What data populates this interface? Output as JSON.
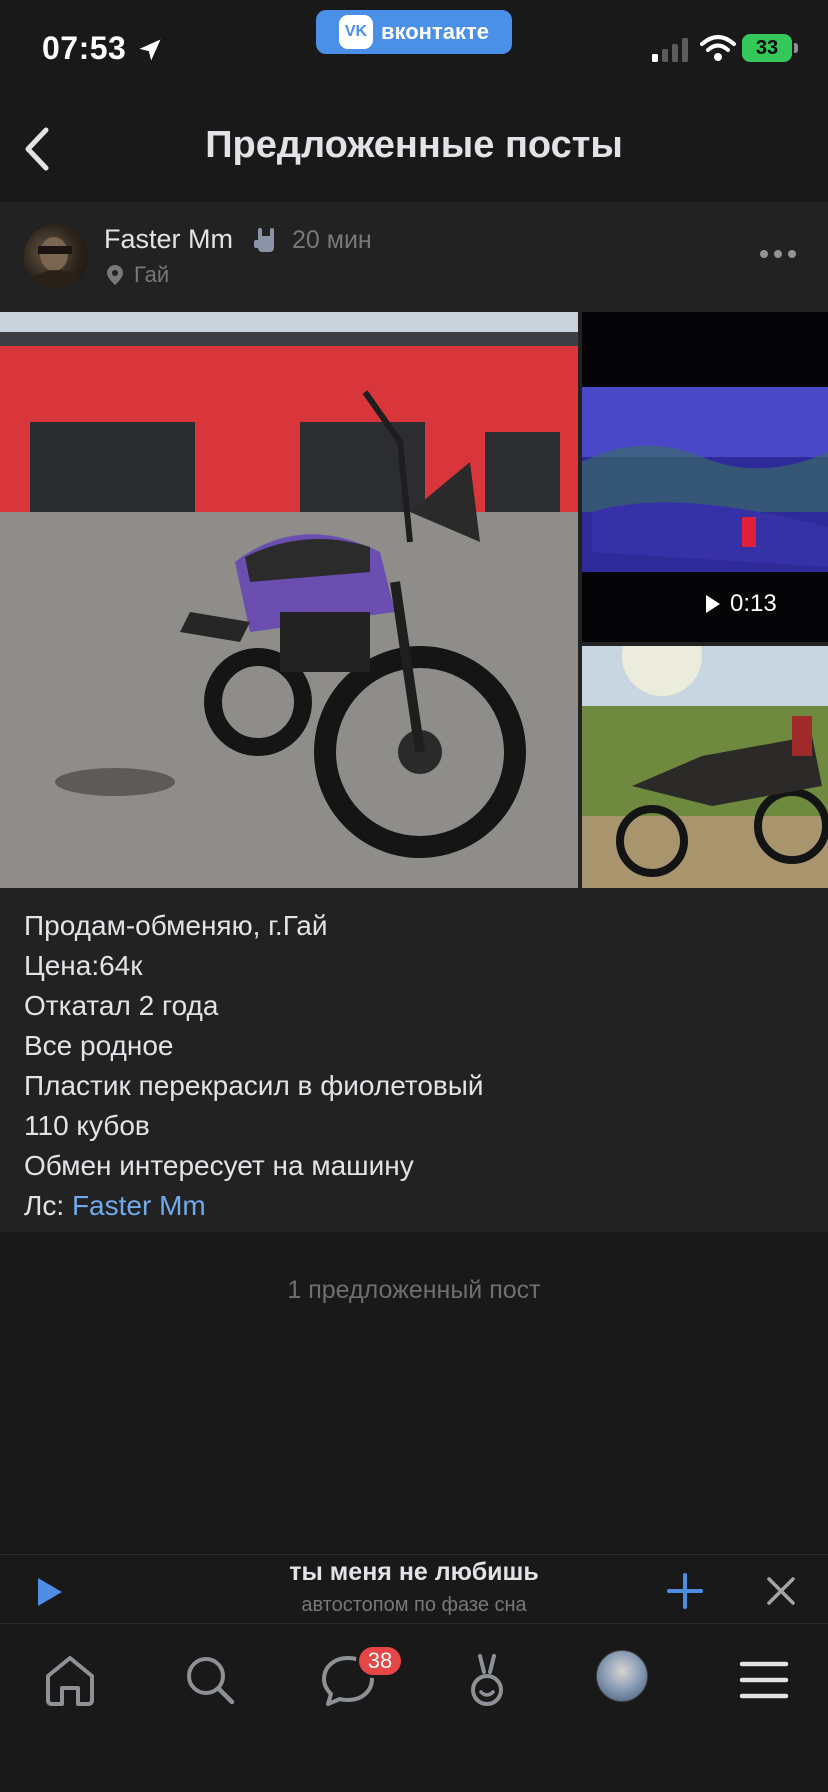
{
  "status_bar": {
    "time": "07:53",
    "vk_label": "вконтакте",
    "vk_logo": "VK",
    "battery": "33"
  },
  "header": {
    "title": "Предложенные посты"
  },
  "post": {
    "author": "Faster Mm",
    "time_ago": "20 мин",
    "location": "Гай",
    "video_duration": "0:13",
    "text_lines": [
      "Продам-обменяю, г.Гай",
      "Цена:64к",
      "Откатал 2 года",
      "Все родное",
      "Пластик перекрасил в фиолетовый",
      "110 кубов",
      "Обмен интересует на машину"
    ],
    "contact_prefix": "Лс: ",
    "contact_link": "Faster Mm"
  },
  "footer_note": "1 предложенный пост",
  "player": {
    "track_title": "ты меня не любишь",
    "track_artist": "автостопом по фазе сна"
  },
  "tab_bar": {
    "messages_badge": "38"
  },
  "colors": {
    "background": "#19191a",
    "card": "#222223",
    "accent": "#4e8de4",
    "link": "#71aaeb",
    "badge": "#e64646",
    "battery": "#34c759"
  }
}
